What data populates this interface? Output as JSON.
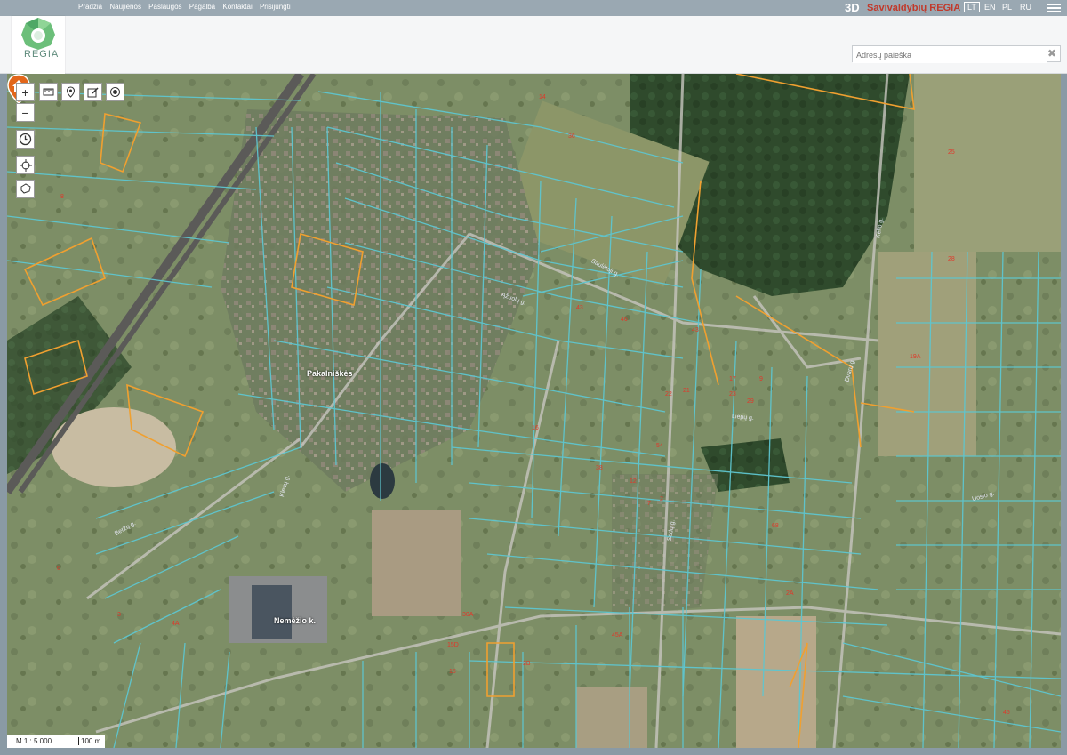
{
  "topbar": {
    "nav": [
      "Pradžia",
      "Naujienos",
      "Paslaugos",
      "Pagalba",
      "Kontaktai",
      "Prisijungti"
    ],
    "btn3d": "3D",
    "brand": "Savivaldybių REGIA",
    "languages": [
      "LT",
      "EN",
      "PL",
      "RU"
    ],
    "active_language": "LT"
  },
  "logo": {
    "text": "REGIA"
  },
  "search": {
    "placeholder": "Adresų paieška",
    "value": ""
  },
  "map": {
    "scale_text": "M 1 : 5 000",
    "scale_length": "100 m",
    "place_names": [
      "Pakalniškės",
      "Nemėžio k."
    ],
    "streets": [
      "Saulėtoji g.",
      "Ąžuolų g.",
      "Kelio g.",
      "Dvarų g.",
      "Liepų g.",
      "Sodų g.",
      "Uosio g.",
      "Klevų g.",
      "Beržų g."
    ],
    "parcel_numbers": [
      "21",
      "22",
      "23",
      "17",
      "19A",
      "25",
      "28",
      "14",
      "45",
      "12",
      "2A",
      "3",
      "38",
      "36",
      "16",
      "7",
      "45A",
      "43",
      "4A",
      "9",
      "54",
      "30A",
      "2B",
      "8",
      "15D",
      "15",
      "2",
      "6",
      "68",
      "43",
      "46",
      "29"
    ],
    "colors": {
      "parcel_line": "#5ec6d0",
      "highlight_line": "#f0a030",
      "parcel_text": "#e0382a",
      "marker": "#e2661a"
    }
  }
}
